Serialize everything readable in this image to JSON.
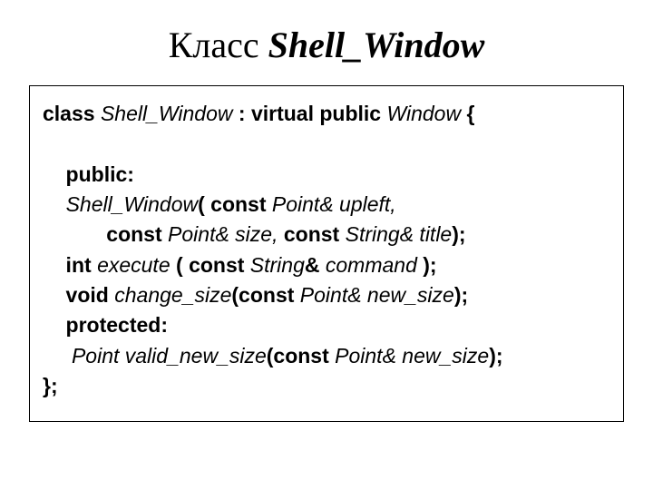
{
  "title": {
    "word": "Класс",
    "name": "Shell_Window"
  },
  "code": {
    "l1": {
      "a": "class ",
      "b": "Shell_Window ",
      "c": ": virtual public ",
      "d": "Window",
      "e": " {"
    },
    "l2": "",
    "l3": {
      "a": "    public:"
    },
    "l4": {
      "a": "    ",
      "b": "Shell_Window",
      "c": "( const ",
      "d": "Point& upleft,",
      "e": " "
    },
    "l5": {
      "a": "           const ",
      "b": "Point& size,",
      "c": " const ",
      "d": "String& title",
      "e": ");"
    },
    "l6": {
      "a": "    int ",
      "b": "execute",
      "c": " ( const ",
      "d": "String",
      "e": "& ",
      "f": "command",
      "g": " );"
    },
    "l7": {
      "a": "    void ",
      "b": "change_size",
      "c": "(const ",
      "d": "Point& new_size",
      "e": ");"
    },
    "l8": {
      "a": "    protected:"
    },
    "l9": {
      "a": "     ",
      "b": "Point valid_new_size",
      "c": "(const ",
      "d": "Point& new_size",
      "e": ");"
    },
    "l10": {
      "a": "};"
    }
  }
}
